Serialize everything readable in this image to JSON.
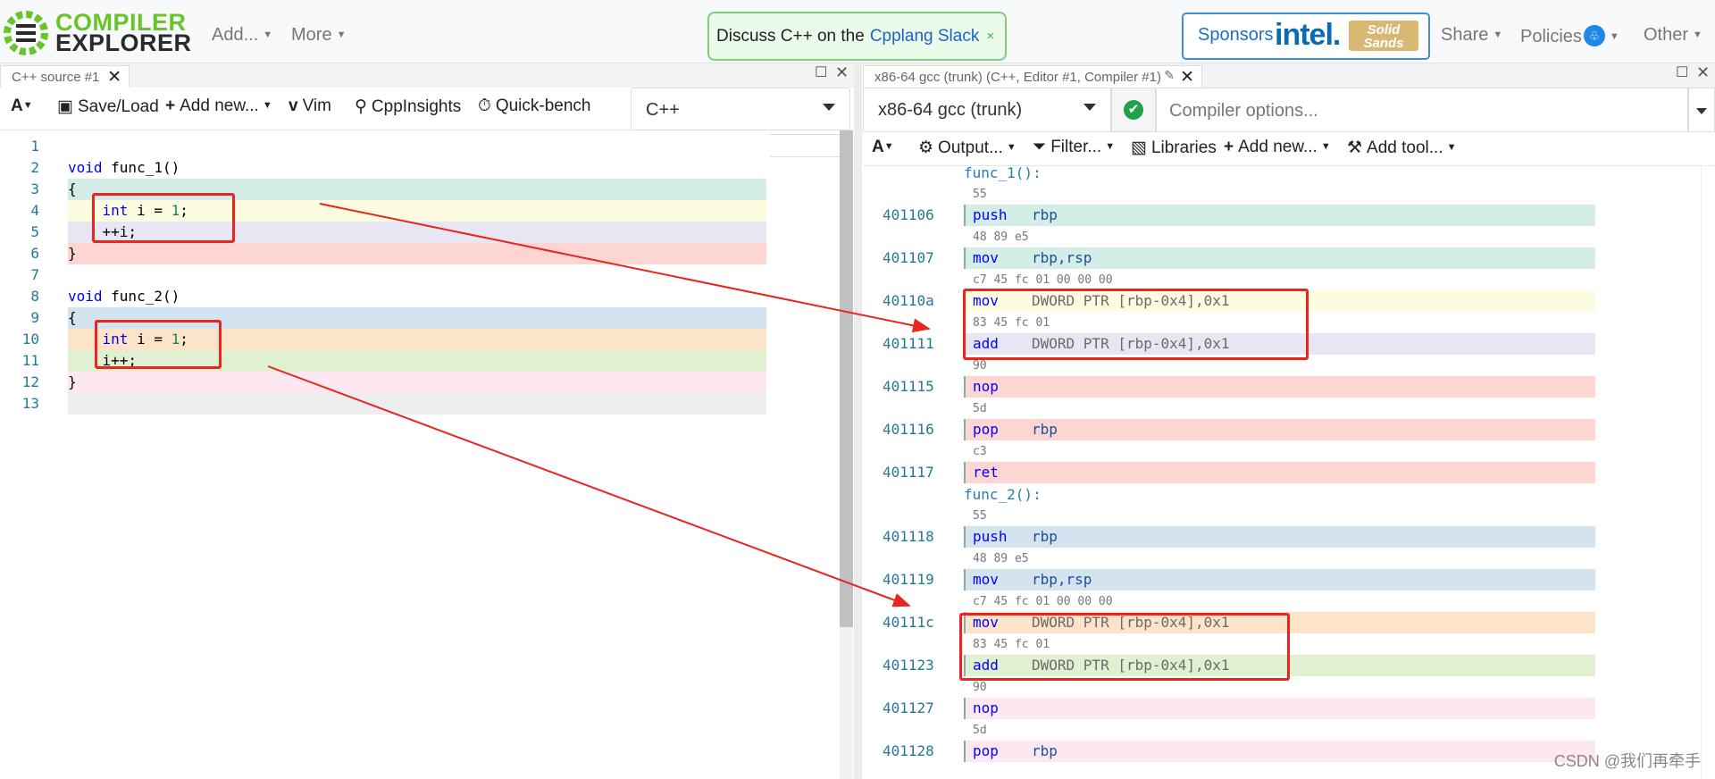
{
  "logo": {
    "line1": "COMPILER",
    "line2": "EXPLORER"
  },
  "nav": {
    "add": "Add...",
    "more": "More",
    "share": "Share",
    "policies": "Policies",
    "other": "Other"
  },
  "discuss": {
    "text": "Discuss C++ on the",
    "link": "Cpplang Slack",
    "close": "×"
  },
  "sponsors": {
    "label": "Sponsors",
    "intel": "intel.",
    "solid_sands": "Solid Sands"
  },
  "left": {
    "tab": "C++ source #1",
    "toolbar": {
      "font": "A",
      "save": "Save/Load",
      "add_new": "Add new...",
      "vim": "Vim",
      "cppinsights": "CppInsights",
      "quickbench": "Quick-bench"
    },
    "language": "C++",
    "lines": [
      {
        "n": "1",
        "t": ""
      },
      {
        "n": "2",
        "t": "void func_1()"
      },
      {
        "n": "3",
        "t": "{"
      },
      {
        "n": "4",
        "t": "    int i = 1;"
      },
      {
        "n": "5",
        "t": "    ++i;"
      },
      {
        "n": "6",
        "t": "}"
      },
      {
        "n": "7",
        "t": ""
      },
      {
        "n": "8",
        "t": "void func_2()"
      },
      {
        "n": "9",
        "t": "{"
      },
      {
        "n": "10",
        "t": "    int i = 1;"
      },
      {
        "n": "11",
        "t": "    i++;"
      },
      {
        "n": "12",
        "t": "}"
      },
      {
        "n": "13",
        "t": ""
      }
    ]
  },
  "right": {
    "tab": "x86-64 gcc (trunk) (C++, Editor #1, Compiler #1)",
    "compiler": "x86-64 gcc (trunk)",
    "options_placeholder": "Compiler options...",
    "toolbar": {
      "font": "A",
      "output": "Output...",
      "filter": "Filter...",
      "libraries": "Libraries",
      "add_new": "Add new...",
      "add_tool": "Add tool..."
    },
    "asm": [
      {
        "kind": "label",
        "text": "func_1():"
      },
      {
        "kind": "hex",
        "text": "55"
      },
      {
        "kind": "ins",
        "addr": "401106",
        "op": "push",
        "args": "rbp",
        "color": "#d4ede7"
      },
      {
        "kind": "hex",
        "text": "48 89 e5"
      },
      {
        "kind": "ins",
        "addr": "401107",
        "op": "mov",
        "args": "rbp,rsp",
        "color": "#d4ede7"
      },
      {
        "kind": "hex",
        "text": "c7 45 fc 01 00 00 00"
      },
      {
        "kind": "ins",
        "addr": "40110a",
        "op": "mov",
        "args": "DWORD PTR [rbp-0x4],0x1",
        "color": "#fdfce0"
      },
      {
        "kind": "hex",
        "text": "83 45 fc 01"
      },
      {
        "kind": "ins",
        "addr": "401111",
        "op": "add",
        "args": "DWORD PTR [rbp-0x4],0x1",
        "color": "#e8e6f2"
      },
      {
        "kind": "hex",
        "text": "90"
      },
      {
        "kind": "ins",
        "addr": "401115",
        "op": "nop",
        "args": "",
        "color": "#fdd6d3"
      },
      {
        "kind": "hex",
        "text": "5d"
      },
      {
        "kind": "ins",
        "addr": "401116",
        "op": "pop",
        "args": "rbp",
        "color": "#fdd6d3"
      },
      {
        "kind": "hex",
        "text": "c3"
      },
      {
        "kind": "ins",
        "addr": "401117",
        "op": "ret",
        "args": "",
        "color": "#fdd6d3"
      },
      {
        "kind": "label",
        "text": "func_2():"
      },
      {
        "kind": "hex",
        "text": "55"
      },
      {
        "kind": "ins",
        "addr": "401118",
        "op": "push",
        "args": "rbp",
        "color": "#d3e3ef"
      },
      {
        "kind": "hex",
        "text": "48 89 e5"
      },
      {
        "kind": "ins",
        "addr": "401119",
        "op": "mov",
        "args": "rbp,rsp",
        "color": "#d3e3ef"
      },
      {
        "kind": "hex",
        "text": "c7 45 fc 01 00 00 00"
      },
      {
        "kind": "ins",
        "addr": "40111c",
        "op": "mov",
        "args": "DWORD PTR [rbp-0x4],0x1",
        "color": "#fde3c8"
      },
      {
        "kind": "hex",
        "text": "83 45 fc 01"
      },
      {
        "kind": "ins",
        "addr": "401123",
        "op": "add",
        "args": "DWORD PTR [rbp-0x4],0x1",
        "color": "#e0f0d0"
      },
      {
        "kind": "hex",
        "text": "90"
      },
      {
        "kind": "ins",
        "addr": "401127",
        "op": "nop",
        "args": "",
        "color": "#fde8f2"
      },
      {
        "kind": "hex",
        "text": "5d"
      },
      {
        "kind": "ins",
        "addr": "401128",
        "op": "pop",
        "args": "rbp",
        "color": "#fde8f2"
      }
    ]
  },
  "colors": {
    "line3": "#d4ede7",
    "line4": "#fdfce0",
    "line5": "#e8e6f2",
    "line6": "#fdd6d3",
    "line9": "#d3e3ef",
    "line10": "#fde3c8",
    "line11": "#e0f0d0",
    "line12": "#fde8f2",
    "line13": "#eeeeee",
    "annotation": "#e8251f"
  },
  "watermark": "CSDN @我们再牵手"
}
